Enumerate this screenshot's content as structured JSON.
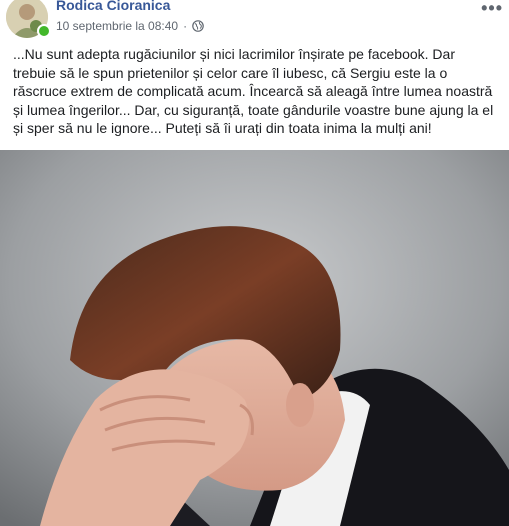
{
  "post": {
    "author": "Rodica Cioranica",
    "timestamp": "10 septembrie la 08:40",
    "separator": "·",
    "privacy_icon": "globe-icon",
    "more_icon": "ellipsis-icon",
    "more_glyph": "•••",
    "text": "...Nu sunt adepta rugăciunilor și nici lacrimilor înșirate pe facebook. Dar trebuie să le spun prietenilor și celor care îl iubesc, că Sergiu este la o răscruce extrem de complicată acum. Încearcă să aleagă între lumea noastră și lumea îngerilor... Dar, cu siguranță, toate gândurile voastre bune ajung la el și sper să nu le ignore... Puteți să îi urați din toata inima la mulți ani!",
    "image_description_icon": "photo-man-facepalm"
  },
  "colors": {
    "author_link": "#385898",
    "meta_text": "#606770",
    "online": "#42b72a",
    "photo_bg": "#7f8285"
  }
}
